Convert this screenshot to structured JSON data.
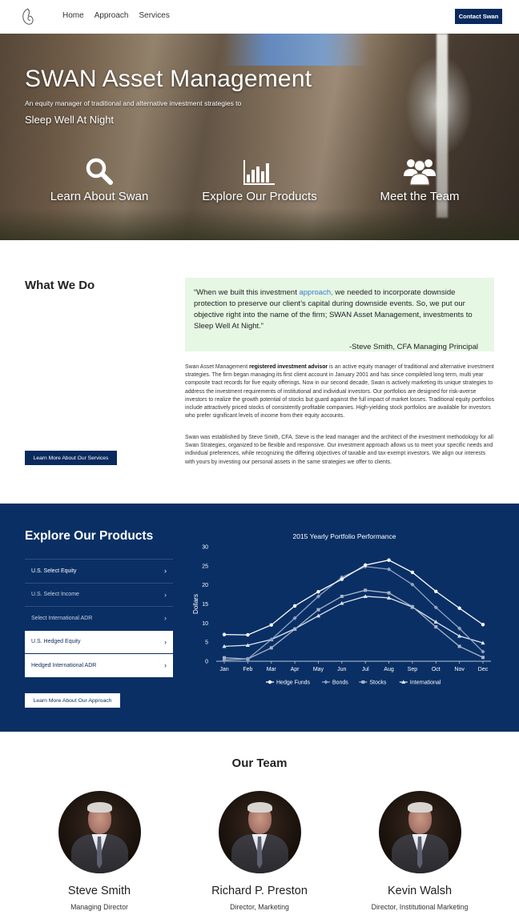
{
  "nav": {
    "links": [
      "Home",
      "Approach",
      "Services"
    ],
    "contact_label": "Contact Swan"
  },
  "hero": {
    "title": "SWAN Asset Management",
    "subtitle": "An equity manager of traditional and alternative investment strategies to",
    "tagline": "Sleep Well At Night",
    "features": [
      {
        "label": "Learn About Swan",
        "icon": "search-icon"
      },
      {
        "label": "Explore Our Products",
        "icon": "bar-chart-icon"
      },
      {
        "label": "Meet the Team",
        "icon": "users-icon"
      }
    ]
  },
  "what_we_do": {
    "title": "What We Do",
    "quote": {
      "before_link": "“When we built this investment ",
      "link": "approach,",
      "after_link": " we needed to incorporate downside protection to preserve our client’s capital during downside events. So, we put our objective right into the name of the firm; SWAN Asset Management, investments to Sleep Well At Night.”",
      "author": "-Steve Smith, CFA Managing Principal"
    },
    "para1_pre": "Swan Asset Management ",
    "para1_bold": "registered investment advisor",
    "para1_post": " is an active equity manager of traditional and alternative investment strategies. The firm began managing its first client account in January 2001 and has since compileled long term, multi year composite tract records for five equity offerings. Now in our second decade, Swan is actively marketing its unique strategies to address the investment requirements of institutional and individual investors. Our portfolios are designed for risk-averse investors to realize the growth potential of stocks but guard against the full impact of market losses. Traditional equity portfolios include attractively priced stocks of consistently profitable companies. High-yielding stock portfolios are available for investors who prefer significant levels of income from their equity accounts.",
    "para2": "Swan was established by Steve Smith, CFA. Steve is the lead manager and the architect of the investment methodology for all Swan Strategies, organized to be flexible and responsive. Our investment approach allows us to meet your specific needs and individual preferences, while recognizing the differing objectives of taxable and tax-exempt investors. We align our interests with yours by investing our personal assets in the same strategies we offer to clients.",
    "button_label": "Learn More About Our Services"
  },
  "products": {
    "title": "Explore Our Products",
    "items": [
      {
        "label": "U.S. Select Equity",
        "active": false
      },
      {
        "label": "U.S. Select Income",
        "active": false
      },
      {
        "label": "Select International ADR",
        "active": false
      },
      {
        "label": "U.S. Hedged Equity",
        "active": true
      },
      {
        "label": "Hedged International ADR",
        "active": true
      }
    ],
    "button_label": "Learn More About Our Approach"
  },
  "chart_data": {
    "type": "line",
    "title": "2015 Yearly Portfolio Performance",
    "xlabel": "",
    "ylabel": "Dollars",
    "ylim": [
      0,
      30
    ],
    "yticks": [
      0,
      5,
      10,
      15,
      20,
      25,
      30
    ],
    "categories": [
      "Jan",
      "Feb",
      "Mar",
      "Apr",
      "May",
      "Jun",
      "Jul",
      "Aug",
      "Sep",
      "Oct",
      "Nov",
      "Dec"
    ],
    "legend_position": "bottom",
    "series": [
      {
        "name": "Hedge Funds",
        "color": "#ffffff",
        "marker": "circle",
        "values": [
          7.0,
          6.9,
          9.5,
          14.5,
          18.2,
          21.5,
          25.2,
          26.5,
          23.3,
          18.3,
          13.9,
          9.6
        ]
      },
      {
        "name": "Bonds",
        "color": "#8fa3c4",
        "marker": "diamond",
        "values": [
          0.3,
          0.6,
          5.7,
          11.3,
          17.0,
          22.0,
          24.8,
          24.1,
          20.1,
          14.1,
          8.6,
          2.5
        ]
      },
      {
        "name": "Stocks",
        "color": "#a9b5c8",
        "marker": "square",
        "values": [
          0.9,
          0.6,
          3.5,
          8.4,
          13.5,
          17.0,
          18.6,
          17.9,
          14.3,
          9.0,
          3.9,
          1.0
        ]
      },
      {
        "name": "International",
        "color": "#dfe6f0",
        "marker": "triangle",
        "values": [
          3.9,
          4.2,
          5.7,
          8.5,
          11.9,
          15.2,
          17.0,
          16.6,
          14.2,
          10.3,
          6.6,
          4.8
        ]
      }
    ]
  },
  "team": {
    "title": "Our Team",
    "members": [
      {
        "name": "Steve Smith",
        "role": "Managing Director"
      },
      {
        "name": "Richard P. Preston",
        "role": "Director, Marketing"
      },
      {
        "name": "Kevin Walsh",
        "role": "Director, Institutional Marketing"
      }
    ]
  }
}
